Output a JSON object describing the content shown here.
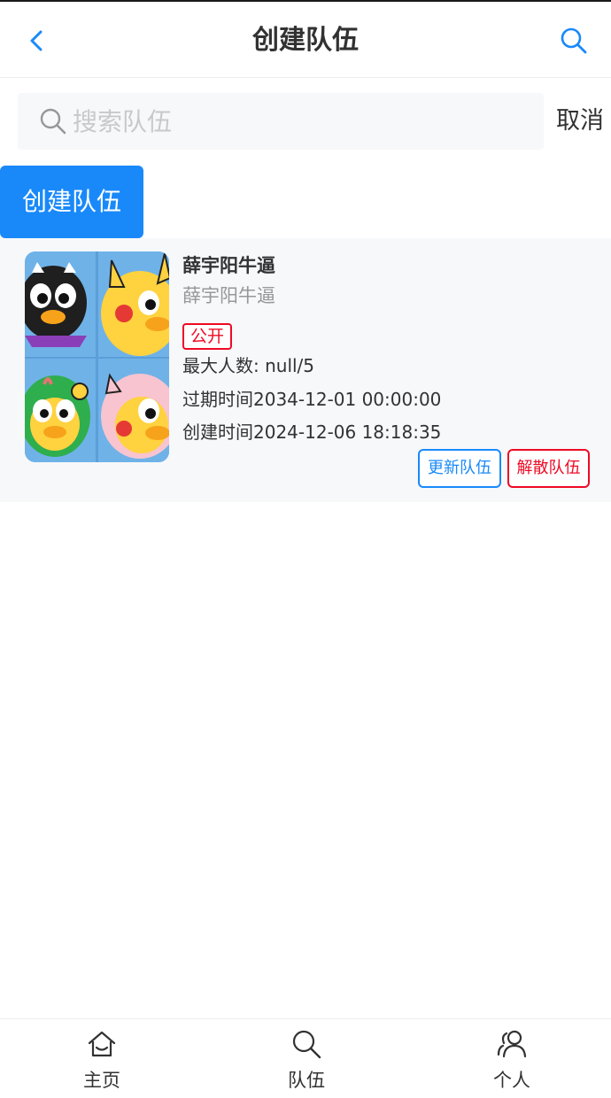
{
  "header": {
    "title": "创建队伍",
    "back_icon": "chevron-left-icon",
    "search_icon": "search-icon"
  },
  "search": {
    "placeholder": "搜索队伍",
    "value": "",
    "cancel_label": "取消"
  },
  "create_button_label": "创建队伍",
  "teams": [
    {
      "name": "薛宇阳牛逼",
      "description": "薛宇阳牛逼",
      "status_tag": "公开",
      "max_members": "最大人数: null/5",
      "expire_time": "过期时间2034-12-01 00:00:00",
      "create_time": "创建时间2024-12-06 18:18:35",
      "update_label": "更新队伍",
      "dissolve_label": "解散队伍"
    }
  ],
  "tabbar": [
    {
      "label": "主页",
      "icon": "home-icon"
    },
    {
      "label": "队伍",
      "icon": "search-icon"
    },
    {
      "label": "个人",
      "icon": "friends-icon"
    }
  ],
  "colors": {
    "primary": "#1989fa",
    "danger": "#ee0a24",
    "muted": "#969799",
    "card_bg": "#f7f8fa"
  }
}
